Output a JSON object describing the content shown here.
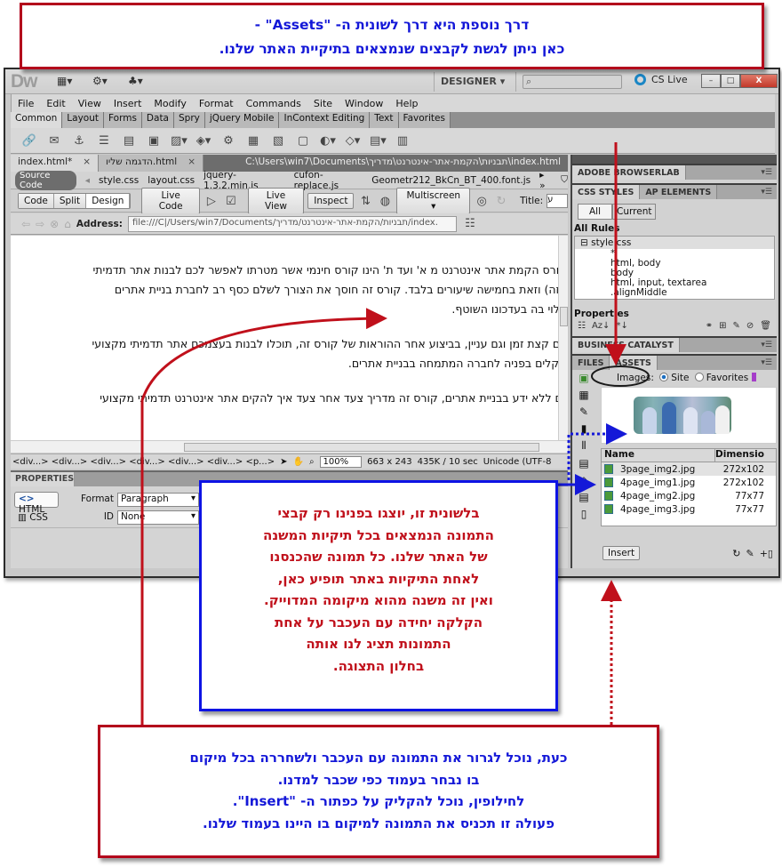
{
  "callouts": {
    "top": [
      "דרך נוספת היא דרך לשונית ה- \"Assets\" -",
      "כאן ניתן לגשת לקבצים שנמצאים בתיקיית האתר שלנו."
    ],
    "middle": [
      "בלשונית זו, יוצגו בפנינו רק קבצי",
      "התמונה הנמצאים בכל תיקיות המשנה",
      "של האתר שלנו. כל תמונה שהכנסנו",
      "לאחת התיקיות באתר תופיע כאן,",
      "ואין זה משנה מהוא מיקומה המדוייק.",
      "הקלקה יחידה עם העכבר על אחת",
      "התמונות תציג לנו אותה",
      "בחלון התצוגה."
    ],
    "bottom": [
      "כעת, נוכל לגרור את התמונה עם העכבר ולשחררה בכל מיקום",
      "בו נבחר בעמוד כפי שכבר למדנו.",
      "לחילופין, נוכל להקליק על כפתור ה- \"Insert\".",
      "פעולה זו תכניס את התמונה למיקום בו היינו בעמוד שלנו."
    ]
  },
  "app": {
    "logo": "Dw",
    "workspace": "DESIGNER",
    "cs_live": "CS Live",
    "search_placeholder": "",
    "window_buttons": [
      "–",
      "□",
      "X"
    ]
  },
  "menu": [
    "File",
    "Edit",
    "View",
    "Insert",
    "Modify",
    "Format",
    "Commands",
    "Site",
    "Window",
    "Help"
  ],
  "insert_tabs": [
    "Common",
    "Layout",
    "Forms",
    "Data",
    "Spry",
    "jQuery Mobile",
    "InContext Editing",
    "Text",
    "Favorites"
  ],
  "toolbar_icons": [
    "hyperlink-icon",
    "email-link-icon",
    "named-anchor-icon",
    "horizontal-rule-icon",
    "table-icon",
    "insert-div-icon",
    "images-icon",
    "media-icon",
    "widget-icon",
    "date-icon",
    "server-side-include-icon",
    "comment-icon",
    "head-icon",
    "script-icon",
    "templates-icon",
    "tag-chooser-icon"
  ],
  "document": {
    "tabs": [
      {
        "label": "index.html*",
        "close": "×"
      },
      {
        "label": "הדגמה שליו.html",
        "close": "×"
      }
    ],
    "path": "C:\\Users\\win7\\Documents\\תבניות\\הקמת-אתר-אינטרנט\\מדריך\\index.html",
    "source_code": "Source Code",
    "related_files": [
      "style.css",
      "layout.css",
      "jquery-1.3.2.min.js",
      "cufon-replace.js",
      "Geometr212_BkCn_BT_400.font.js"
    ],
    "view_buttons": [
      "Code",
      "Split",
      "Design"
    ],
    "live_code": "Live Code",
    "live_view": "Live View",
    "inspect": "Inspect",
    "multiscreen": "Multiscreen",
    "title_label": "Title:",
    "title_value": "ע",
    "address_label": "Address:",
    "address_value": "file:///C|/Users/win7/Documents/תבניות/הקמת-אתר-אינטרנט/מדריך/index.",
    "content": [
      "קורס הקמת אתר אינטרנט מ א' ועד ת' הינו קורס חינמי אשר מטרתו לאפשר לכם לבנות אתר תדמיתי",
      "הזה) וזאת בחמישה שיעורים בלבד. קורס זה חוסך את הצורך לשלם כסף רב לחברת בניית אתרים",
      "תלוי בה בעדכונו השוטף.",
      "עם קצת זמן וגם עניין, בביצוע אחר ההוראות של קורס זה, תוכלו לבנות בעצמכם אתר תדמיתי מקצועי",
      "שקלים בפניה לחברה המתמחה בבניית אתרים.",
      "גם ללא ידע בבניית אתרים, קורס זה מדריך צעד אחר צעד איך להקים אתר אינטרנט תדמיתי מקצועי"
    ],
    "tag_selector": "<div...> <div...> <div...> <div...> <div...> <div...> <p...>",
    "zoom": "100%",
    "window_size": "663 x 243",
    "download": "435K / 10 sec",
    "encoding": "Unicode (UTF-8"
  },
  "properties": {
    "title": "PROPERTIES",
    "html_btn": "HTML",
    "css_btn": "CSS",
    "format_label": "Format",
    "format_value": "Paragraph",
    "id_label": "ID",
    "id_value": "None"
  },
  "panels": {
    "browserlab": "ADOBE BROWSERLAB",
    "css_styles": "CSS STYLES",
    "ap_elements": "AP ELEMENTS",
    "all": "All",
    "current": "Current",
    "all_rules": "All Rules",
    "stylesheet": "style.css",
    "rules": [
      "*",
      "html, body",
      "body",
      "html, input, textarea",
      ".alignMiddle"
    ],
    "properties": "Properties",
    "business_catalyst": "BUSINESS CATALYST",
    "files": "FILES",
    "assets": "ASSETS",
    "images_label": "Images:",
    "site_option": "Site",
    "favorites_option": "Favorites",
    "col_name": "Name",
    "col_dimensions": "Dimensio",
    "assets_list": [
      {
        "name": "3page_img2.jpg",
        "dim": "272x102"
      },
      {
        "name": "4page_img1.jpg",
        "dim": "272x102"
      },
      {
        "name": "4page_img2.jpg",
        "dim": "77x77"
      },
      {
        "name": "4page_img3.jpg",
        "dim": "77x77"
      }
    ],
    "insert": "Insert"
  }
}
